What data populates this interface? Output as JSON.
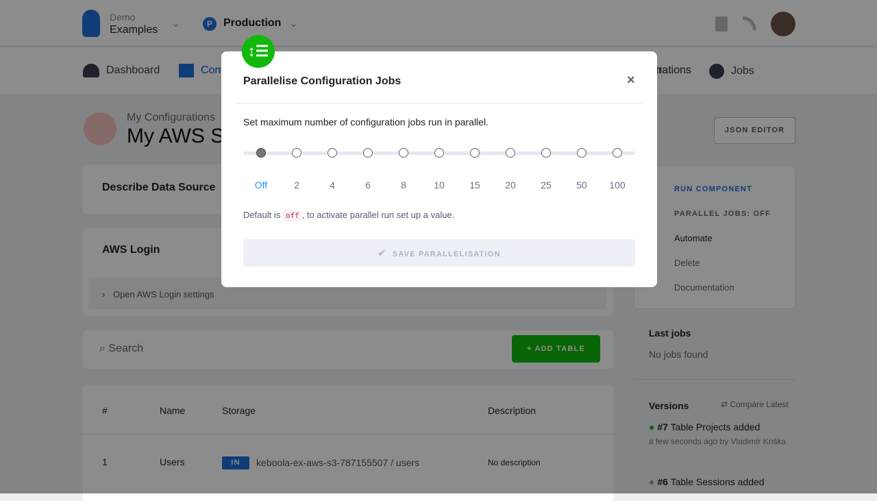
{
  "header": {
    "org": "Demo",
    "project": "Examples",
    "branch_badge": "P",
    "branch": "Production"
  },
  "nav": {
    "items": [
      "Dashboard",
      "Components",
      "Orchestrations",
      "Jobs"
    ],
    "partial": [
      "Con",
      "nations"
    ]
  },
  "page": {
    "breadcrumb": "My Configurations",
    "title": "My AWS S",
    "json_editor": "JSON EDITOR"
  },
  "main": {
    "describe": "Describe Data Source",
    "aws_login": "AWS Login",
    "open_settings": "Open AWS Login settings",
    "search": "Search",
    "add_table": "ADD TABLE",
    "table": {
      "headers": [
        "#",
        "Name",
        "Storage",
        "Description"
      ],
      "rows": [
        {
          "num": "1",
          "name": "Users",
          "badge": "IN",
          "storage": "keboola-ex-aws-s3-787155507 / users",
          "description": "No description"
        }
      ]
    }
  },
  "sidebar": {
    "actions": [
      "RUN COMPONENT",
      "PARALLEL JOBS: OFF",
      "Automate",
      "Delete",
      "Documentation"
    ],
    "last_jobs": "Last jobs",
    "no_jobs": "No jobs found",
    "versions": "Versions",
    "compare": "Compare Latest",
    "version_list": [
      {
        "num": "#7",
        "title": "Table Projects added",
        "meta": "a few seconds ago by Vladimír Kriška"
      },
      {
        "num": "#6",
        "title": "Table Sessions added"
      }
    ]
  },
  "modal": {
    "title": "Parallelise Configuration Jobs",
    "description": "Set maximum number of configuration jobs run in parallel.",
    "options": [
      "Off",
      "2",
      "4",
      "6",
      "8",
      "10",
      "15",
      "20",
      "25",
      "50",
      "100"
    ],
    "selected": "Off",
    "help_prefix": "Default is",
    "help_code": "off",
    "help_suffix": ", to activate parallel run set up a value.",
    "save": "SAVE PARALLELISATION"
  },
  "colors": {
    "accent": "#1f8fff",
    "green": "#10b90c"
  }
}
